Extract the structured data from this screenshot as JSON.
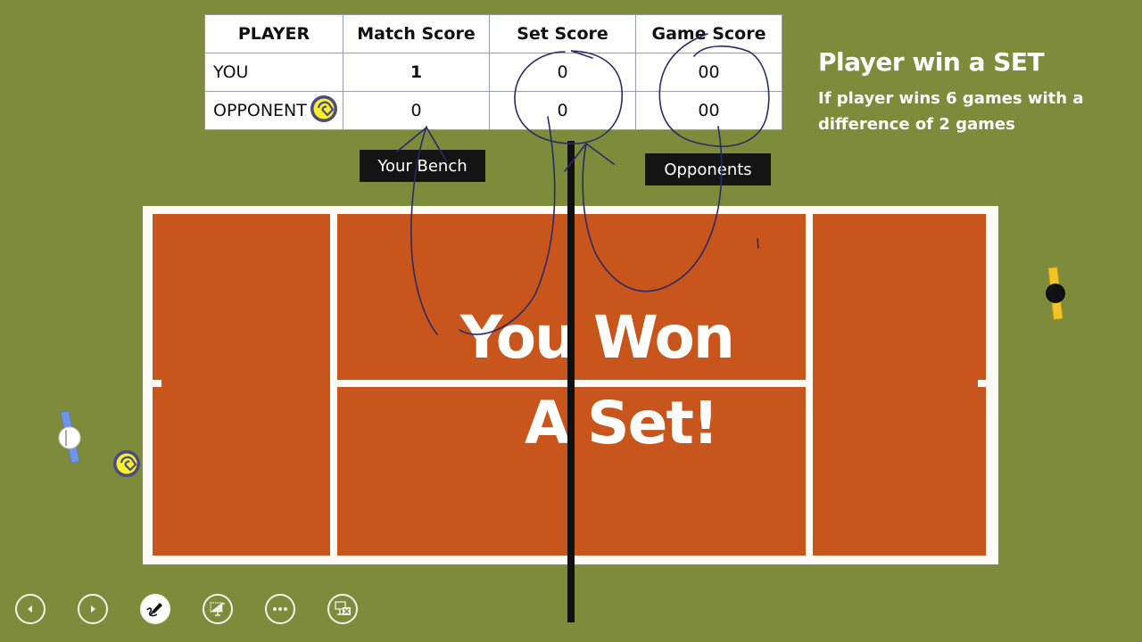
{
  "scoreboard": {
    "headers": [
      "PLAYER",
      "Match Score",
      "Set Score",
      "Game Score"
    ],
    "rows": [
      {
        "player": "YOU",
        "match": "1",
        "set": "0",
        "game": "00",
        "has_ball": false
      },
      {
        "player": "OPPONENT",
        "match": "0",
        "set": "0",
        "game": "00",
        "has_ball": true
      }
    ]
  },
  "info": {
    "title": "Player win a SET",
    "body": "If player wins 6 games with a difference of 2 games"
  },
  "labels": {
    "your_bench": "Your Bench",
    "opponents": "Opponents"
  },
  "court": {
    "message_line1": "You Won",
    "message_line2": "A Set!"
  },
  "colors": {
    "background": "#7d8b3a",
    "court": "#c8561c",
    "lines": "#fdfbf5",
    "ink": "#2a2a66",
    "player_you": "#6f95e6",
    "player_opponent": "#f2c324"
  },
  "toolbar": {
    "buttons": [
      {
        "name": "previous",
        "icon": "prev-icon"
      },
      {
        "name": "next",
        "icon": "next-icon"
      },
      {
        "name": "pen",
        "icon": "pen-icon",
        "active": true
      },
      {
        "name": "see-all-slides",
        "icon": "slides-icon"
      },
      {
        "name": "more-options",
        "icon": "more-icon"
      },
      {
        "name": "end-show",
        "icon": "end-show-icon"
      }
    ]
  }
}
